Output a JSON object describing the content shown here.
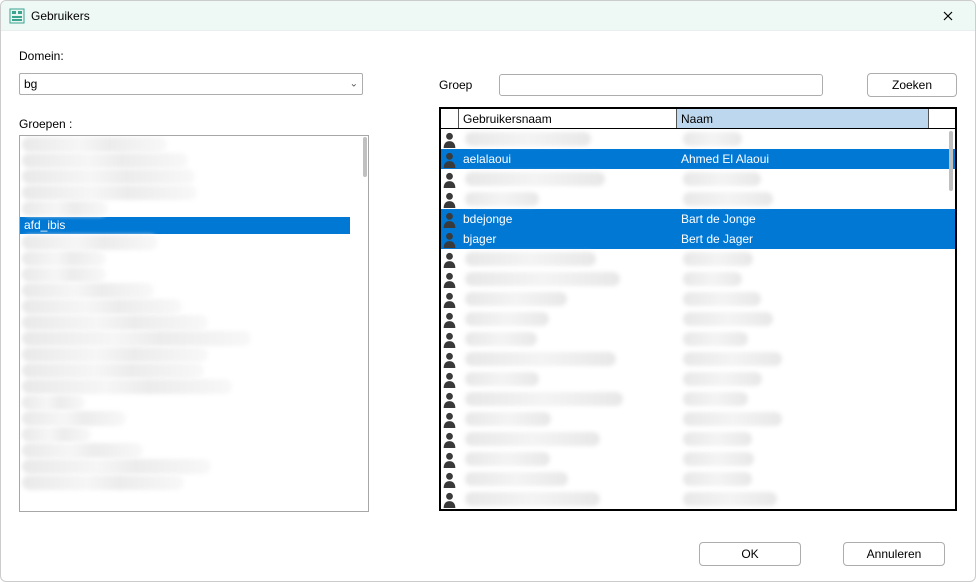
{
  "window": {
    "title": "Gebruikers"
  },
  "left": {
    "domain_label": "Domein:",
    "domain_value": "bg",
    "groups_label": "Groepen :",
    "selected_group": "afd_ibis"
  },
  "right": {
    "groep_label": "Groep",
    "groep_value": "",
    "zoeken_label": "Zoeken",
    "headers": {
      "username": "Gebruikersnaam",
      "name": "Naam"
    },
    "rows": [
      {
        "type": "blur"
      },
      {
        "type": "sel",
        "username": "aelalaoui",
        "name": "Ahmed El Alaoui"
      },
      {
        "type": "blur"
      },
      {
        "type": "blur"
      },
      {
        "type": "sel",
        "username": "bdejonge",
        "name": "Bart de Jonge"
      },
      {
        "type": "sel",
        "username": "bjager",
        "name": "Bert de Jager"
      },
      {
        "type": "blur"
      },
      {
        "type": "blur"
      },
      {
        "type": "blur"
      },
      {
        "type": "blur"
      },
      {
        "type": "blur"
      },
      {
        "type": "blur"
      },
      {
        "type": "blur"
      },
      {
        "type": "blur"
      },
      {
        "type": "blur"
      },
      {
        "type": "blur"
      },
      {
        "type": "blur"
      },
      {
        "type": "blur"
      },
      {
        "type": "blur"
      }
    ]
  },
  "footer": {
    "ok": "OK",
    "cancel": "Annuleren"
  }
}
